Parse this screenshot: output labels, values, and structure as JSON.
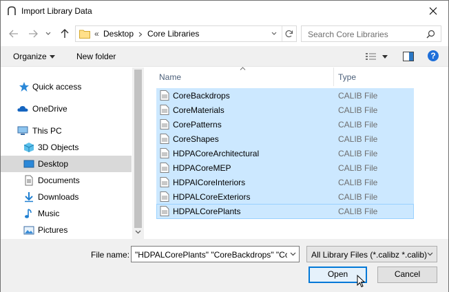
{
  "window": {
    "title": "Import Library Data"
  },
  "nav": {
    "path": [
      "Desktop",
      "Core Libraries"
    ],
    "overflow": "«",
    "search_placeholder": "Search Core Libraries"
  },
  "toolbar": {
    "organize_label": "Organize",
    "new_folder_label": "New folder"
  },
  "sidebar": {
    "items": [
      {
        "label": "Quick access",
        "icon": "star-icon"
      },
      {
        "label": "OneDrive",
        "icon": "cloud-icon"
      },
      {
        "label": "This PC",
        "icon": "computer-icon"
      },
      {
        "label": "3D Objects",
        "icon": "cube-icon"
      },
      {
        "label": "Desktop",
        "icon": "desktop-icon",
        "selected": true
      },
      {
        "label": "Documents",
        "icon": "document-icon"
      },
      {
        "label": "Downloads",
        "icon": "download-icon"
      },
      {
        "label": "Music",
        "icon": "music-icon"
      },
      {
        "label": "Pictures",
        "icon": "pictures-icon"
      }
    ]
  },
  "file_list": {
    "columns": [
      "Name",
      "Type"
    ],
    "rows": [
      {
        "name": "CoreBackdrops",
        "type": "CALIB File"
      },
      {
        "name": "CoreMaterials",
        "type": "CALIB File"
      },
      {
        "name": "CorePatterns",
        "type": "CALIB File"
      },
      {
        "name": "CoreShapes",
        "type": "CALIB File"
      },
      {
        "name": "HDPACoreArchitectural",
        "type": "CALIB File"
      },
      {
        "name": "HDPACoreMEP",
        "type": "CALIB File"
      },
      {
        "name": "HDPAICoreInteriors",
        "type": "CALIB File"
      },
      {
        "name": "HDPALCoreExteriors",
        "type": "CALIB File"
      },
      {
        "name": "HDPALCorePlants",
        "type": "CALIB File"
      }
    ]
  },
  "footer": {
    "file_name_label": "File name:",
    "file_name_value": "\"HDPALCorePlants\" \"CoreBackdrops\" \"Co",
    "filter_value": "All Library Files (*.calibz *.calib)",
    "open_label": "Open",
    "cancel_label": "Cancel"
  },
  "colors": {
    "selection": "#cce8ff",
    "accent": "#0078d7",
    "help": "#1e6fd9"
  }
}
